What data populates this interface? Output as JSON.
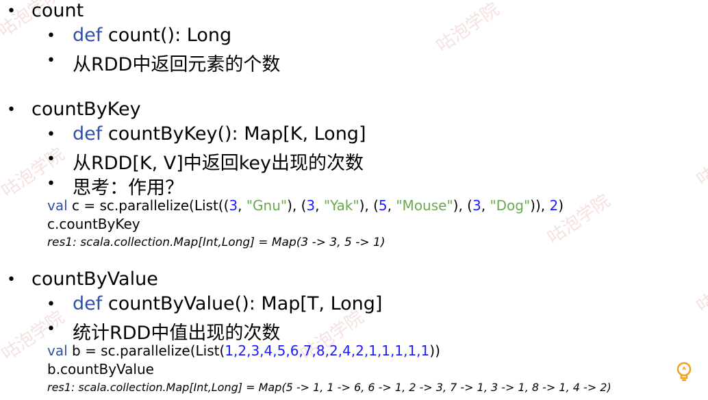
{
  "watermark": "咕泡学院",
  "sections": [
    {
      "title": "count",
      "def_kw": "def",
      "signature": " count(): Long",
      "desc": "从RDD中返回元素的个数"
    },
    {
      "title": "countByKey",
      "def_kw": "def",
      "signature": " countByKey(): Map[K, Long]",
      "desc": "从RDD[K, V]中返回key出现的次数",
      "extra": "思考：作用？",
      "code1": [
        "val",
        " c = sc.parallelize(List((",
        "3",
        ", ",
        "\"Gnu\"",
        "), (",
        "3",
        ", ",
        "\"Yak\"",
        "), (",
        "5",
        ", ",
        "\"Mouse\"",
        "), (",
        "3",
        ", ",
        "\"Dog\"",
        ")), ",
        "2",
        ")"
      ],
      "code2": "c.countByKey",
      "result": "res1: scala.collection.Map[Int,Long] = Map(3 -> 3, 5 -> 1)"
    },
    {
      "title": "countByValue",
      "def_kw": "def",
      "signature": " countByValue(): Map[T, Long]",
      "desc": "统计RDD中值出现的次数",
      "code1": [
        "val",
        " b = sc.parallelize(List(",
        "1,2,3,4,5,6,7,8,2,4,2,1,1,1,1,1",
        "))"
      ],
      "code2": "b.countByValue",
      "result": "res1: scala.collection.Map[Int,Long] = Map(5 -> 1, 1 -> 6, 6 -> 1, 2 -> 3, 7 -> 1, 3 -> 1, 8 -> 1, 4 -> 2)"
    }
  ],
  "bullet": "•",
  "bulb_icon": "lightbulb-icon"
}
